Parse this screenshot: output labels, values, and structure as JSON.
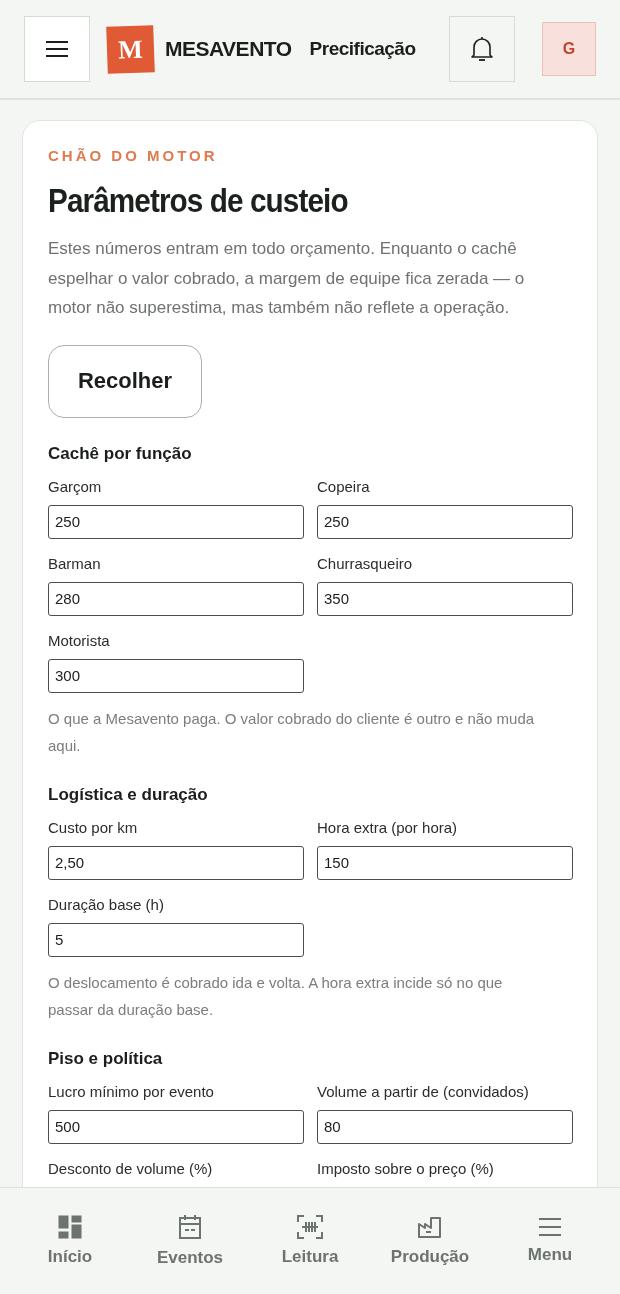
{
  "header": {
    "logo_letter": "M",
    "brand": "MESAVENTO",
    "page_title": "Precificação",
    "avatar": "G"
  },
  "card": {
    "eyebrow": "CHÃO DO MOTOR",
    "title": "Parâmetros de custeio",
    "intro": "Estes números entram em todo orçamento. Enquanto o cachê espelhar o valor cobrado, a margem de equipe fica zerada — o motor não superestima, mas também não reflete a operação.",
    "collapse_button": "Recolher",
    "sections": [
      {
        "title": "Cachê por função",
        "fields": [
          {
            "label": "Garçom",
            "value": "250"
          },
          {
            "label": "Copeira",
            "value": "250"
          },
          {
            "label": "Barman",
            "value": "280"
          },
          {
            "label": "Churrasqueiro",
            "value": "350"
          },
          {
            "label": "Motorista",
            "value": "300"
          }
        ],
        "note": "O que a Mesavento paga. O valor cobrado do cliente é outro e não muda aqui."
      },
      {
        "title": "Logística e duração",
        "fields": [
          {
            "label": "Custo por km",
            "value": "2,50"
          },
          {
            "label": "Hora extra (por hora)",
            "value": "150"
          },
          {
            "label": "Duração base (h)",
            "value": "5"
          }
        ],
        "note": "O deslocamento é cobrado ida e volta. A hora extra incide só no que passar da duração base."
      },
      {
        "title": "Piso e política",
        "fields": [
          {
            "label": "Lucro mínimo por evento",
            "value": "500"
          },
          {
            "label": "Volume a partir de (convidados)",
            "value": "80"
          }
        ],
        "trailing_labels": [
          "Desconto de volume (%)",
          "Imposto sobre o preço (%)"
        ]
      }
    ]
  },
  "bottom_nav": [
    {
      "kind": "dashboard",
      "label": "Início",
      "selected": false
    },
    {
      "kind": "calendar",
      "label": "Eventos",
      "selected": false
    },
    {
      "kind": "scan",
      "label": "Leitura",
      "selected": false
    },
    {
      "kind": "factory",
      "label": "Produção",
      "selected": false
    },
    {
      "kind": "menu",
      "label": "Menu",
      "selected": false
    }
  ]
}
